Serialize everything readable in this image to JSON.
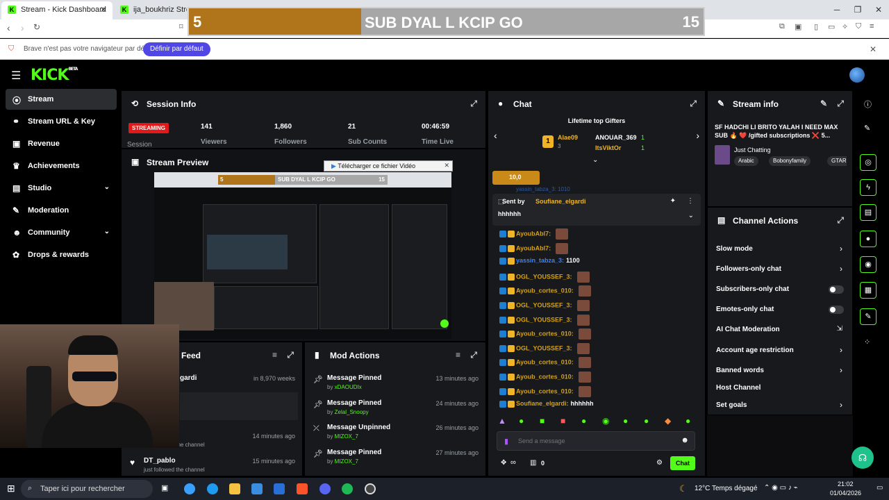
{
  "browser": {
    "tabs": [
      {
        "title": "Stream - Kick Dashboard"
      },
      {
        "title": "ija_boukhriz Stream - W"
      }
    ],
    "infobar": {
      "message": "Brave n'est pas votre navigateur par défaut",
      "button": "Définir par défaut"
    }
  },
  "overlay": {
    "count": "5",
    "title": "SUB DYAL L KCIP GO",
    "goal": "15"
  },
  "download_popup": "Télécharger ce fichier Vidéo",
  "header": {
    "logo": "KICK",
    "logo_tag": "BETA"
  },
  "sidebar": {
    "items": [
      {
        "label": "Stream",
        "icon": "stream-icon"
      },
      {
        "label": "Stream URL & Key",
        "icon": "link-icon"
      },
      {
        "label": "Revenue",
        "icon": "wallet-icon"
      },
      {
        "label": "Achievements",
        "icon": "trophy-icon"
      },
      {
        "label": "Studio",
        "icon": "studio-icon"
      },
      {
        "label": "Moderation",
        "icon": "wrench-icon"
      },
      {
        "label": "Community",
        "icon": "community-icon"
      },
      {
        "label": "Drops & rewards",
        "icon": "gift-icon"
      }
    ]
  },
  "session": {
    "title": "Session Info",
    "status": "STREAMING",
    "status_label": "Session",
    "stats": [
      {
        "value": "141",
        "label": "Viewers"
      },
      {
        "value": "1,860",
        "label": "Followers"
      },
      {
        "value": "21",
        "label": "Sub Counts"
      },
      {
        "value": "00:46:59",
        "label": "Time Live"
      }
    ]
  },
  "preview": {
    "title": "Stream Preview",
    "banner_count": "5",
    "banner_title": "SUB DYAL L KCIP GO",
    "banner_goal": "15"
  },
  "feed": {
    "title": "Feed",
    "items": [
      {
        "name": "gardi",
        "time": "in 8,970 weeks",
        "sub": ""
      },
      {
        "name": "",
        "time": "14 minutes ago",
        "sub": "just followed the channel"
      },
      {
        "name": "DT_pablo",
        "time": "15 minutes ago",
        "sub": "just followed the channel"
      }
    ]
  },
  "mod_actions": {
    "title": "Mod Actions",
    "items": [
      {
        "action": "Message Pinned",
        "by": "xDAOUDIx",
        "time": "13 minutes ago"
      },
      {
        "action": "Message Pinned",
        "by": "Zelal_Snoopy",
        "time": "24 minutes ago"
      },
      {
        "action": "Message Unpinned",
        "by": "MIZOX_7",
        "time": "26 minutes ago"
      },
      {
        "action": "Message Pinned",
        "by": "MIZOX_7",
        "time": "27 minutes ago"
      }
    ]
  },
  "chat": {
    "title": "Chat",
    "gifters_title": "Lifetime top Gifters",
    "gifters": [
      {
        "rank": "1",
        "name": "Alae09",
        "count": "3"
      },
      {
        "name": "ANOUAR_369",
        "count": "1"
      },
      {
        "name": "ItsViktOr",
        "count": "1"
      }
    ],
    "kicks_badge": "10,0",
    "partial_line": "yassin_tabza_3: 1010",
    "pinned": {
      "label": "Sent by",
      "user": "Soufiane_elgardi",
      "text": "hhhhhh"
    },
    "messages": [
      {
        "user": "AyoubAbl7:",
        "text": "",
        "color": "#d4a017",
        "emote": true
      },
      {
        "user": "AyoubAbl7:",
        "text": "",
        "color": "#d4a017",
        "emote": true
      },
      {
        "user": "yassin_tabza_3:",
        "text": "1100",
        "color": "#3b82f6",
        "emote": false
      },
      {
        "user": "OGL_YOUSSEF_3:",
        "text": "",
        "color": "#d4a017",
        "emote": true
      },
      {
        "user": "Ayoub_cortes_010:",
        "text": "",
        "color": "#d4a017",
        "emote": true
      },
      {
        "user": "OGL_YOUSSEF_3:",
        "text": "",
        "color": "#d4a017",
        "emote": true
      },
      {
        "user": "OGL_YOUSSEF_3:",
        "text": "",
        "color": "#d4a017",
        "emote": true
      },
      {
        "user": "Ayoub_cortes_010:",
        "text": "",
        "color": "#d4a017",
        "emote": true
      },
      {
        "user": "OGL_YOUSSEF_3:",
        "text": "",
        "color": "#d4a017",
        "emote": true
      },
      {
        "user": "Ayoub_cortes_010:",
        "text": "",
        "color": "#d4a017",
        "emote": true
      },
      {
        "user": "Ayoub_cortes_010:",
        "text": "",
        "color": "#d4a017",
        "emote": true
      },
      {
        "user": "Ayoub_cortes_010:",
        "text": "",
        "color": "#d4a017",
        "emote": true
      },
      {
        "user": "Soufiane_elgardi:",
        "text": "hhhhhh",
        "color": "#d4a017",
        "emote": false
      }
    ],
    "input_placeholder": "Send a message",
    "viewer_count": "0",
    "send_button": "Chat"
  },
  "stream_info": {
    "title": "Stream info",
    "stream_title": "SF HADCHI LI BRITO YALAH I NEED MAX SUB 🔥 ❤️ /gifted subscriptions ❌ 5...",
    "category": "Just Chatting",
    "tags": [
      "Arabic",
      "Bobonyfamily",
      "GTARP"
    ]
  },
  "channel_actions": {
    "title": "Channel Actions",
    "items": [
      {
        "label": "Slow mode",
        "control": "chevron"
      },
      {
        "label": "Followers-only chat",
        "control": "chevron"
      },
      {
        "label": "Subscribers-only chat",
        "control": "toggle"
      },
      {
        "label": "Emotes-only chat",
        "control": "toggle"
      },
      {
        "label": "AI Chat Moderation",
        "control": "external"
      },
      {
        "label": "Account age restriction",
        "control": "chevron"
      },
      {
        "label": "Banned words",
        "control": "chevron"
      },
      {
        "label": "Host Channel",
        "control": "none"
      },
      {
        "label": "Set goals",
        "control": "chevron"
      }
    ]
  },
  "taskbar": {
    "search_placeholder": "Taper ici pour rechercher",
    "weather": "12°C  Temps dégagé",
    "time": "21:02",
    "date": "01/04/2026"
  },
  "colors": {
    "accent": "#53fc18",
    "panel": "#18191d",
    "streaming": "#e01a1a"
  }
}
